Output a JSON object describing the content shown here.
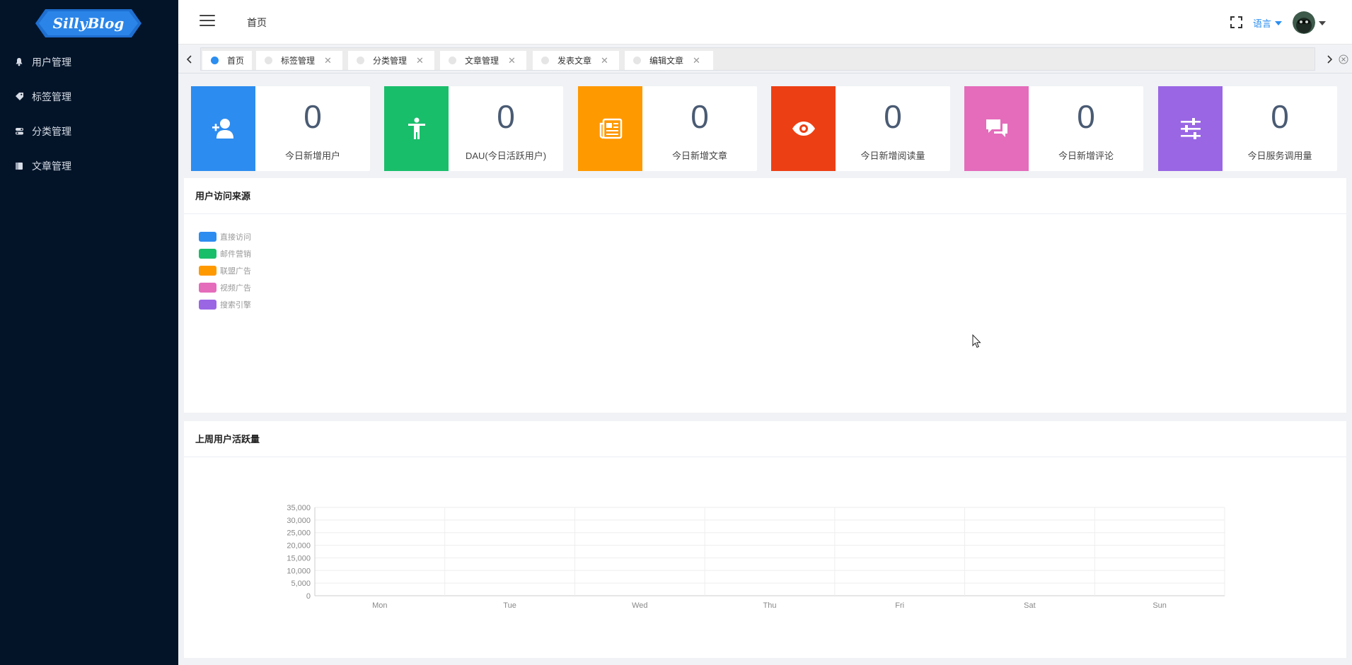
{
  "app": {
    "logo": "SillyBlog",
    "colors": {
      "sidebar_bg": "#031429",
      "accent": "#2b8ef0"
    }
  },
  "sidebar": {
    "items": [
      {
        "label": "用户管理",
        "icon": "user-icon"
      },
      {
        "label": "标签管理",
        "icon": "tag-icon"
      },
      {
        "label": "分类管理",
        "icon": "category-icon"
      },
      {
        "label": "文章管理",
        "icon": "article-icon"
      }
    ]
  },
  "header": {
    "breadcrumb": "首页",
    "language_label": "语言"
  },
  "tabs": [
    {
      "label": "首页",
      "active": true,
      "closable": false
    },
    {
      "label": "标签管理",
      "active": false,
      "closable": true
    },
    {
      "label": "分类管理",
      "active": false,
      "closable": true
    },
    {
      "label": "文章管理",
      "active": false,
      "closable": true
    },
    {
      "label": "发表文章",
      "active": false,
      "closable": true
    },
    {
      "label": "编辑文章",
      "active": false,
      "closable": true
    }
  ],
  "stats": [
    {
      "value": "0",
      "label": "今日新增用户",
      "color": "#2d8cf0",
      "icon": "add-user-icon"
    },
    {
      "value": "0",
      "label": "DAU(今日活跃用户)",
      "color": "#19be6b",
      "icon": "accessibility-icon"
    },
    {
      "value": "0",
      "label": "今日新增文章",
      "color": "#ff9900",
      "icon": "newspaper-icon"
    },
    {
      "value": "0",
      "label": "今日新增阅读量",
      "color": "#ed3f14",
      "icon": "eye-icon"
    },
    {
      "value": "0",
      "label": "今日新增评论",
      "color": "#e46cbb",
      "icon": "chat-icon"
    },
    {
      "value": "0",
      "label": "今日服务调用量",
      "color": "#9a66e4",
      "icon": "sliders-icon"
    }
  ],
  "visit_source": {
    "title": "用户访问来源",
    "legend": [
      {
        "name": "直接访问",
        "color": "#2d8cf0"
      },
      {
        "name": "邮件营销",
        "color": "#19be6b"
      },
      {
        "name": "联盟广告",
        "color": "#ff9900"
      },
      {
        "name": "视频广告",
        "color": "#e46cbb"
      },
      {
        "name": "搜索引擎",
        "color": "#9a66e4"
      }
    ]
  },
  "weekly_active": {
    "title": "上周用户活跃量"
  },
  "chart_data": {
    "type": "bar",
    "title": "上周用户活跃量",
    "categories": [
      "Mon",
      "Tue",
      "Wed",
      "Thu",
      "Fri",
      "Sat",
      "Sun"
    ],
    "y_ticks": [
      "0",
      "5,000",
      "10,000",
      "15,000",
      "20,000",
      "25,000",
      "30,000",
      "35,000"
    ],
    "ylim": [
      0,
      35000
    ],
    "values": [],
    "grid": true
  }
}
